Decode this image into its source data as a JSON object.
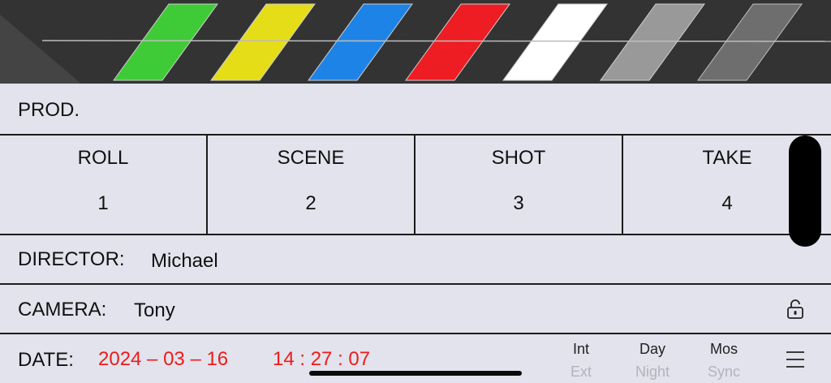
{
  "colors": {
    "background": "#e2e3ec",
    "clapper": "#333333",
    "date_text": "#ee1b1b",
    "stripes": [
      "#3fcb37",
      "#e6dd19",
      "#1e83e6",
      "#ee1d23",
      "#ffffff",
      "#999999",
      "#6e6e6e"
    ]
  },
  "prod": {
    "label": "PROD.",
    "value": ""
  },
  "slate": {
    "roll": {
      "label": "ROLL",
      "value": "1"
    },
    "scene": {
      "label": "SCENE",
      "value": "2"
    },
    "shot": {
      "label": "SHOT",
      "value": "3"
    },
    "take": {
      "label": "TAKE",
      "value": "4"
    }
  },
  "director": {
    "label": "DIRECTOR:",
    "value": "Michael"
  },
  "camera": {
    "label": "CAMERA:",
    "value": "Tony"
  },
  "date": {
    "label": "DATE:",
    "date_value": "2024 – 03 – 16",
    "time_value": "14 : 27 : 07"
  },
  "toggles": [
    {
      "on": "Int",
      "off": "Ext"
    },
    {
      "on": "Day",
      "off": "Night"
    },
    {
      "on": "Mos",
      "off": "Sync"
    }
  ],
  "icons": {
    "lock": "lock-open-icon",
    "menu": "menu-icon"
  }
}
